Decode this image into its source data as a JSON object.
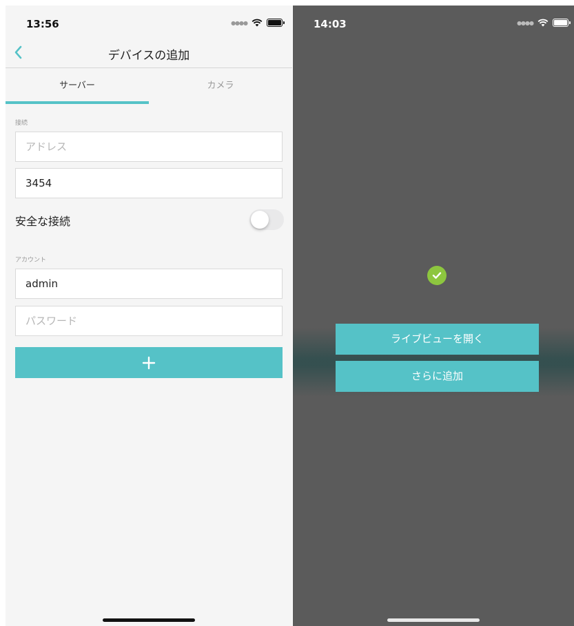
{
  "left": {
    "status": {
      "time": "13:56"
    },
    "nav": {
      "title": "デバイスの追加",
      "back_icon": "chevron-left-icon"
    },
    "tabs": [
      {
        "label": "サーバー"
      },
      {
        "label": "カメラ"
      }
    ],
    "connection": {
      "section_label": "接続",
      "address_placeholder": "アドレス",
      "port_value": "3454",
      "secure_label": "安全な接続",
      "secure_enabled": false
    },
    "account": {
      "section_label": "アカウント",
      "username_value": "admin",
      "password_placeholder": "パスワード"
    },
    "add_button": {
      "icon": "plus-icon"
    }
  },
  "right": {
    "status": {
      "time": "14:03"
    },
    "success_icon": "checkmark-icon",
    "buttons": {
      "open_live_view": "ライブビューを開く",
      "add_more": "さらに追加"
    }
  },
  "colors": {
    "accent": "#55c2c7",
    "success": "#8dc63f",
    "overlay_bg": "#5b5b5b",
    "screen_bg": "#f5f5f5"
  }
}
